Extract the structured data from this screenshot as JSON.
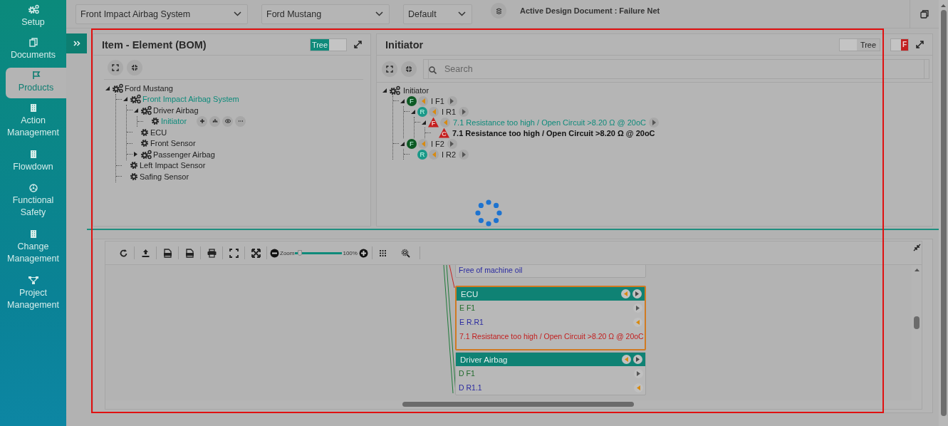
{
  "sidebar": {
    "items": [
      {
        "label": "Setup",
        "selected": false
      },
      {
        "label": "Documents",
        "selected": false
      },
      {
        "label": "Products",
        "selected": true
      },
      {
        "label": "Action Management",
        "selected": false
      },
      {
        "label": "Flowdown",
        "selected": false
      },
      {
        "label": "Functional Safety",
        "selected": false
      },
      {
        "label": "Change Management",
        "selected": false
      },
      {
        "label": "Project Management",
        "selected": false
      }
    ]
  },
  "top_bar": {
    "dropdowns": [
      {
        "value": "Front Impact Airbag System"
      },
      {
        "value": "Ford Mustang"
      },
      {
        "value": "Default"
      }
    ],
    "active_document": "Active Design Document : Failure Net"
  },
  "bom_panel": {
    "title": "Item - Element (BOM)",
    "view_toggle": {
      "label": "Tree",
      "on": true
    },
    "tree": [
      {
        "label": "Ford Mustang",
        "kind": "assembly",
        "expanded": true,
        "highlighted": false,
        "children": [
          {
            "label": "Front Impact Airbag System",
            "kind": "assembly",
            "expanded": true,
            "highlighted": true,
            "children": [
              {
                "label": "Driver Airbag",
                "kind": "assembly",
                "expanded": true,
                "highlighted": false,
                "children": [
                  {
                    "label": "Initiator",
                    "kind": "part",
                    "highlighted": true,
                    "show_actions": true
                  }
                ]
              },
              {
                "label": "ECU",
                "kind": "part",
                "highlighted": false
              },
              {
                "label": "Front Sensor",
                "kind": "part",
                "highlighted": false
              },
              {
                "label": "Passenger Airbag",
                "kind": "assembly",
                "expanded": false,
                "highlighted": false
              }
            ]
          },
          {
            "label": "Left Impact Sensor",
            "kind": "part",
            "highlighted": false
          },
          {
            "label": "Safing Sensor",
            "kind": "part",
            "highlighted": false
          }
        ]
      }
    ]
  },
  "initiator_panel": {
    "title": "Initiator",
    "view_toggle": {
      "label": "Tree",
      "on": false
    },
    "flag_toggle": {
      "label": "F",
      "on": true
    },
    "search": {
      "placeholder": "Search"
    },
    "tree": [
      {
        "label": "Initiator",
        "kind": "group",
        "expanded": true,
        "children": [
          {
            "badge": "F",
            "label": "I F1",
            "kind": "function",
            "expanded": true,
            "prev_link": true,
            "next_link": true,
            "children": [
              {
                "badge": "R",
                "label": "I R1",
                "kind": "requirement",
                "expanded": true,
                "prev_link": true,
                "next_link": true,
                "children": [
                  {
                    "badge": "F",
                    "label": "7.1 Resistance too high / Open Circuit >8.20 Ω @ 20oC",
                    "kind": "failure",
                    "expanded": true,
                    "prev_link": true,
                    "next_link": true,
                    "children": [
                      {
                        "badge": "C",
                        "label": "7.1 Resistance too high / Open Circuit >8.20 Ω @ 20oC",
                        "kind": "cause"
                      }
                    ]
                  }
                ]
              }
            ]
          },
          {
            "badge": "F",
            "label": "I F2",
            "kind": "function",
            "expanded": true,
            "prev_link": true,
            "next_link": true,
            "children": [
              {
                "badge": "R",
                "label": "I R2",
                "kind": "requirement",
                "prev_link": true,
                "next_link": true
              }
            ]
          }
        ]
      }
    ]
  },
  "loading": true,
  "diagram_panel": {
    "toolbar": {
      "zoom_label": "Zoom",
      "zoom_value": "100%",
      "level": 0.1
    },
    "cards": [
      {
        "selected": false,
        "rows": [
          {
            "text": "Free of machine oil",
            "color": "#2a2aa0"
          }
        ]
      },
      {
        "title": "ECU",
        "selected": true,
        "rows": [
          {
            "text": "E F1",
            "color": "#1f6a2a",
            "next_link": true
          },
          {
            "text": "E R.R1",
            "color": "#2a2aa0",
            "prev_link": true
          },
          {
            "text": "7.1 Resistance too high / Open Circuit >8.20 Ω @ 20oC",
            "color": "#c21d1d"
          }
        ]
      },
      {
        "title": "Driver Airbag",
        "selected": false,
        "rows": [
          {
            "text": "D F1",
            "color": "#1f6a2a",
            "next_link": true
          },
          {
            "text": "D R1.1",
            "color": "#2a2aa0",
            "prev_link": true
          }
        ]
      }
    ]
  }
}
